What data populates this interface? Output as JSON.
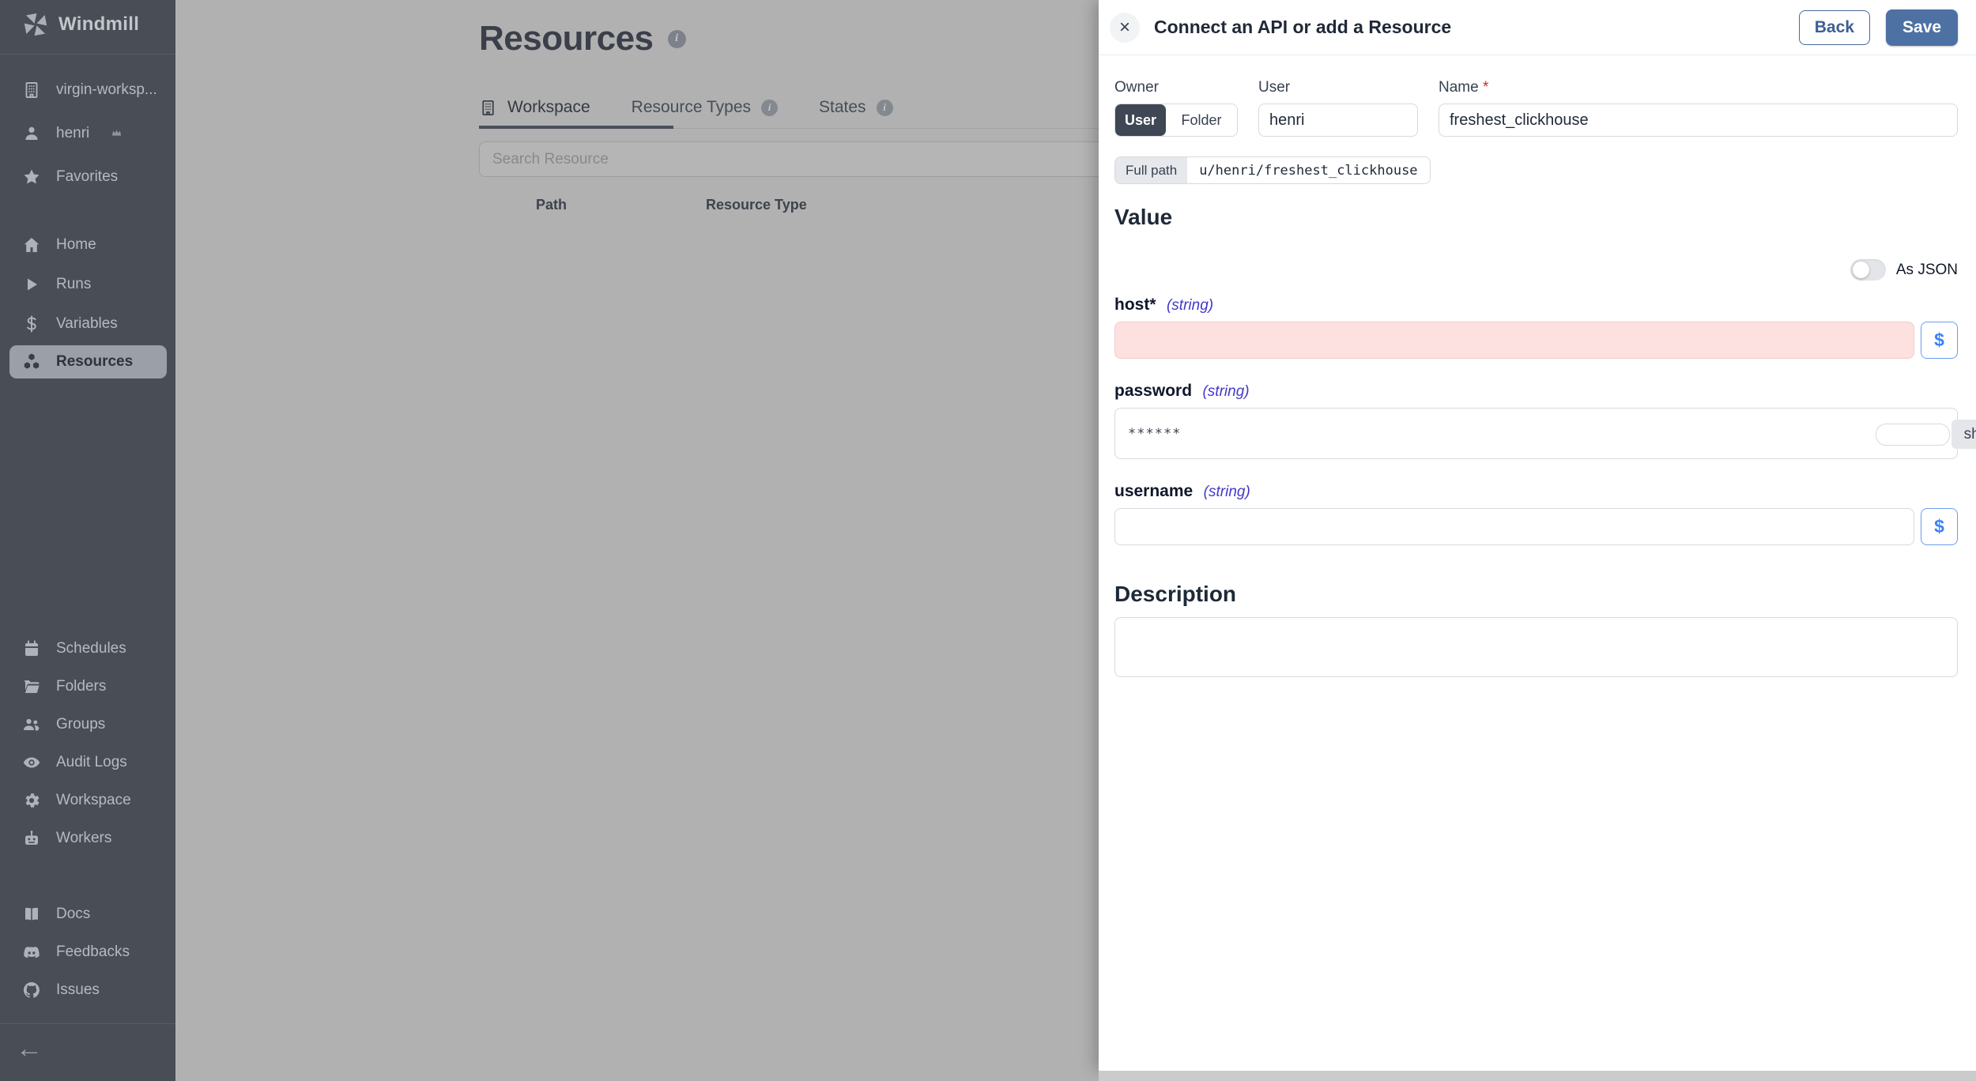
{
  "app": {
    "logo_text": "Windmill"
  },
  "sidebar": {
    "workspace_switcher": "virgin-worksp...",
    "user": "henri",
    "favorites": "Favorites",
    "nav": [
      {
        "label": "Home"
      },
      {
        "label": "Runs"
      },
      {
        "label": "Variables"
      },
      {
        "label": "Resources",
        "active": true
      }
    ],
    "admin_nav": [
      {
        "label": "Schedules"
      },
      {
        "label": "Folders"
      },
      {
        "label": "Groups"
      },
      {
        "label": "Audit Logs"
      },
      {
        "label": "Workspace"
      },
      {
        "label": "Workers"
      }
    ],
    "footer_nav": [
      {
        "label": "Docs"
      },
      {
        "label": "Feedbacks"
      },
      {
        "label": "Issues"
      }
    ]
  },
  "main": {
    "title": "Resources",
    "tabs": [
      {
        "label": "Workspace",
        "active": true
      },
      {
        "label": "Resource Types",
        "info": true
      },
      {
        "label": "States",
        "info": true
      }
    ],
    "search_placeholder": "Search Resource",
    "table": {
      "columns": [
        "Path",
        "Resource Type"
      ]
    }
  },
  "drawer": {
    "title": "Connect an API or add a Resource",
    "close_glyph": "×",
    "back_label": "Back",
    "save_label": "Save",
    "owner": {
      "label": "Owner",
      "options": [
        "User",
        "Folder"
      ],
      "selected": "User"
    },
    "user_field": {
      "label": "User",
      "value": "henri"
    },
    "name_field": {
      "label": "Name",
      "required_mark": "*",
      "value": "freshest_clickhouse"
    },
    "full_path": {
      "label": "Full path",
      "value": "u/henri/freshest_clickhouse"
    },
    "value_section": {
      "title": "Value",
      "as_json_label": "As JSON",
      "as_json_enabled": false,
      "dollar_label": "$",
      "fields": [
        {
          "name": "host",
          "type": "(string)",
          "required_mark": "*",
          "value": "",
          "invalid": true
        },
        {
          "name": "password",
          "type": "(string)",
          "value": "******",
          "show_label": "show"
        },
        {
          "name": "username",
          "type": "(string)",
          "value": ""
        }
      ]
    },
    "description_section": {
      "title": "Description",
      "value": ""
    }
  },
  "icons": {
    "collapse_glyph": "←",
    "names": [
      "windmill-logo",
      "building",
      "user",
      "crown",
      "star",
      "home",
      "play",
      "dollar",
      "cubes",
      "calendar",
      "folder",
      "users",
      "eye",
      "gear",
      "robot",
      "book",
      "discord",
      "github",
      "info",
      "close",
      "left-arrow"
    ]
  },
  "colors": {
    "sidebar_bg": "#484d56",
    "sidebar_active_bg": "#9b9fa7",
    "dim_overlay_bg": "#b1b1b1",
    "accent_steel_blue": "#4d71a3",
    "dollar_blue": "#3b82f6",
    "invalid_field_bg": "#fce1e0",
    "string_type_text": "#4338ca",
    "required_red": "#dc2626"
  }
}
